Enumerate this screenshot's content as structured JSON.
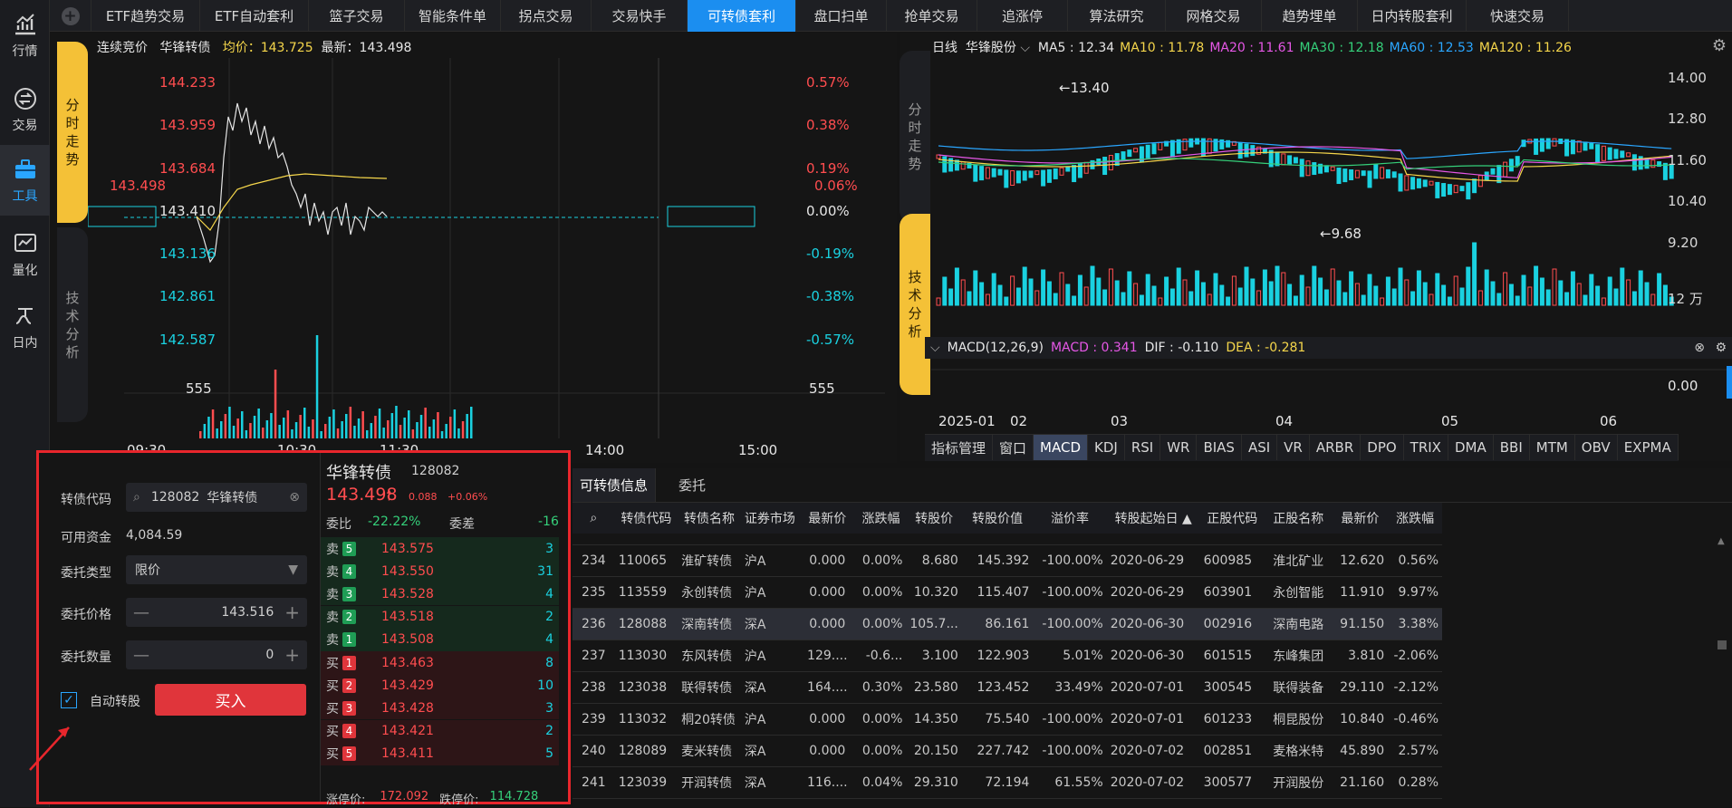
{
  "nav": [
    {
      "label": "行情",
      "icon": "chart-icon"
    },
    {
      "label": "交易",
      "icon": "exchange-icon"
    },
    {
      "label": "工具",
      "icon": "toolbox-icon",
      "active": true
    },
    {
      "label": "量化",
      "icon": "quant-icon"
    },
    {
      "label": "日内",
      "icon": "intraday-icon"
    }
  ],
  "tabs": [
    {
      "label": "ETF趋势交易",
      "w": 120
    },
    {
      "label": "ETF自动套利",
      "w": 120
    },
    {
      "label": "篮子交易",
      "w": 106
    },
    {
      "label": "智能条件单",
      "w": 106
    },
    {
      "label": "拐点交易",
      "w": 100
    },
    {
      "label": "交易快手",
      "w": 106
    },
    {
      "label": "可转债套利",
      "w": 120,
      "active": true
    },
    {
      "label": "盘口扫单",
      "w": 100
    },
    {
      "label": "抢单交易",
      "w": 100
    },
    {
      "label": "追涨停",
      "w": 100
    },
    {
      "label": "算法研究",
      "w": 108
    },
    {
      "label": "网格交易",
      "w": 106
    },
    {
      "label": "趋势埋单",
      "w": 106
    },
    {
      "label": "日内转股套利",
      "w": 120
    },
    {
      "label": "快速交易",
      "w": 113
    }
  ],
  "intraday": {
    "mode": "连续竞价",
    "name": "华锋转债",
    "avg_label": "均价：",
    "avg": "143.725",
    "last_label": "最新：",
    "last": "143.498",
    "side_label_top": [
      "分",
      "时",
      "走",
      "势"
    ],
    "side_label_bottom": [
      "技",
      "术",
      "分",
      "析"
    ],
    "prices": [
      "144.233",
      "143.959",
      "143.684",
      "143.410",
      "143.136",
      "142.861",
      "142.587"
    ],
    "pcts": [
      "0.57%",
      "0.38%",
      "0.19%",
      "0.00%",
      "-0.19%",
      "-0.38%",
      "-0.57%"
    ],
    "cur_price": "143.498",
    "cur_pct": "0.06%",
    "vol_left": "555",
    "vol_right": "555",
    "times": [
      "09:30",
      "10:30",
      "11:30",
      "14:00",
      "15:00"
    ]
  },
  "daily": {
    "period": "日线",
    "name": "华锋股份",
    "ma": [
      {
        "k": "MA5",
        "v": "12.34",
        "c": "#e6e6e6"
      },
      {
        "k": "MA10",
        "v": "11.78",
        "c": "#f5d64b"
      },
      {
        "k": "MA20",
        "v": "11.61",
        "c": "#e657e6"
      },
      {
        "k": "MA30",
        "v": "12.18",
        "c": "#35d07a"
      },
      {
        "k": "MA60",
        "v": "12.53",
        "c": "#2aa6ff"
      },
      {
        "k": "MA120",
        "v": "11.26",
        "c": "#f5d64b"
      }
    ],
    "yticks": [
      "14.00",
      "12.80",
      "11.60",
      "10.40",
      "9.20"
    ],
    "vol_tick": "12 万",
    "high_note": "←13.40",
    "low_note": "←9.68",
    "side_top": [
      "分",
      "时",
      "走",
      "势"
    ],
    "side_bottom": [
      "技",
      "术",
      "分",
      "析"
    ],
    "macd": {
      "name": "MACD(12,26,9)",
      "macd": "MACD : 0.341",
      "dif": "DIF : -0.110",
      "dea": "DEA : -0.281",
      "tick": "0.00"
    },
    "xlabels": [
      "2025-01",
      "02",
      "03",
      "04",
      "05",
      "06"
    ],
    "indicators": [
      {
        "label": "指标管理"
      },
      {
        "label": "窗口"
      },
      {
        "label": "MACD",
        "active": true
      },
      {
        "label": "KDJ"
      },
      {
        "label": "RSI"
      },
      {
        "label": "WR"
      },
      {
        "label": "BIAS"
      },
      {
        "label": "ASI"
      },
      {
        "label": "VR"
      },
      {
        "label": "ARBR"
      },
      {
        "label": "DPO"
      },
      {
        "label": "TRIX"
      },
      {
        "label": "DMA"
      },
      {
        "label": "BBI"
      },
      {
        "label": "MTM"
      },
      {
        "label": "OBV"
      },
      {
        "label": "EXPMA"
      }
    ]
  },
  "order": {
    "code_label": "转债代码",
    "code_value": "128082",
    "code_name": "华锋转债",
    "funds_label": "可用资金",
    "funds": "4,084.59",
    "type_label": "委托类型",
    "type_value": "限价",
    "price_label": "委托价格",
    "price_value": "143.516",
    "qty_label": "委托数量",
    "qty_value": "0",
    "auto_label": "自动转股",
    "buy_label": "买入"
  },
  "book": {
    "name": "华锋转债",
    "code": "128082",
    "price": "143.498",
    "chg": "0.088",
    "pct": "+0.06%",
    "ratio_label": "委比",
    "ratio": "-22.22%",
    "diff_label": "委差",
    "diff": "-16",
    "asks": [
      {
        "l": "卖",
        "n": "5",
        "p": "143.575",
        "q": "3"
      },
      {
        "l": "卖",
        "n": "4",
        "p": "143.550",
        "q": "31"
      },
      {
        "l": "卖",
        "n": "3",
        "p": "143.528",
        "q": "4"
      },
      {
        "l": "卖",
        "n": "2",
        "p": "143.518",
        "q": "2"
      },
      {
        "l": "卖",
        "n": "1",
        "p": "143.508",
        "q": "4"
      }
    ],
    "bids": [
      {
        "l": "买",
        "n": "1",
        "p": "143.463",
        "q": "8"
      },
      {
        "l": "买",
        "n": "2",
        "p": "143.429",
        "q": "10"
      },
      {
        "l": "买",
        "n": "3",
        "p": "143.428",
        "q": "3"
      },
      {
        "l": "买",
        "n": "4",
        "p": "143.421",
        "q": "2"
      },
      {
        "l": "买",
        "n": "5",
        "p": "143.411",
        "q": "5"
      }
    ],
    "up_label": "涨停价:",
    "up": "172.092",
    "down_label": "跌停价:",
    "down": "114.728"
  },
  "table": {
    "tab1": "可转债信息",
    "tab2": "委托",
    "headers": [
      "转债代码",
      "转债名称",
      "证券市场",
      "最新价",
      "涨跌幅",
      "转股价",
      "转股价值",
      "溢价率",
      "转股起始日 ▲",
      "正股代码",
      "正股名称",
      "最新价",
      "涨跌幅"
    ],
    "rows": [
      [
        "234",
        "110065",
        "淮矿转债",
        "沪A",
        "0.000",
        "0.00%",
        "8.680",
        "145.392",
        "-100.00%",
        "2020-06-29",
        "600985",
        "淮北矿业",
        "12.620",
        "0.56%"
      ],
      [
        "235",
        "113559",
        "永创转债",
        "沪A",
        "0.000",
        "0.00%",
        "10.320",
        "115.407",
        "-100.00%",
        "2020-06-29",
        "603901",
        "永创智能",
        "11.910",
        "9.97%"
      ],
      [
        "236",
        "128088",
        "深南转债",
        "深A",
        "0.000",
        "0.00%",
        "105.7...",
        "86.161",
        "-100.00%",
        "2020-06-30",
        "002916",
        "深南电路",
        "91.150",
        "3.38%"
      ],
      [
        "237",
        "113030",
        "东风转债",
        "沪A",
        "129....",
        "-0.6...",
        "3.100",
        "122.903",
        "5.01%",
        "2020-06-30",
        "601515",
        "东峰集团",
        "3.810",
        "-2.06%"
      ],
      [
        "238",
        "123038",
        "联得转债",
        "深A",
        "164....",
        "0.30%",
        "23.580",
        "123.452",
        "33.49%",
        "2020-07-01",
        "300545",
        "联得装备",
        "29.110",
        "-2.12%"
      ],
      [
        "239",
        "113032",
        "桐20转债",
        "沪A",
        "0.000",
        "0.00%",
        "14.350",
        "75.540",
        "-100.00%",
        "2020-07-01",
        "601233",
        "桐昆股份",
        "10.840",
        "-0.46%"
      ],
      [
        "240",
        "128089",
        "麦米转债",
        "深A",
        "0.000",
        "0.00%",
        "20.150",
        "227.742",
        "-100.00%",
        "2020-07-02",
        "002851",
        "麦格米特",
        "45.890",
        "2.57%"
      ],
      [
        "241",
        "123039",
        "开润转债",
        "深A",
        "116....",
        "0.04%",
        "29.310",
        "72.194",
        "61.55%",
        "2020-07-02",
        "300577",
        "开润股份",
        "21.160",
        "0.28%"
      ]
    ]
  }
}
